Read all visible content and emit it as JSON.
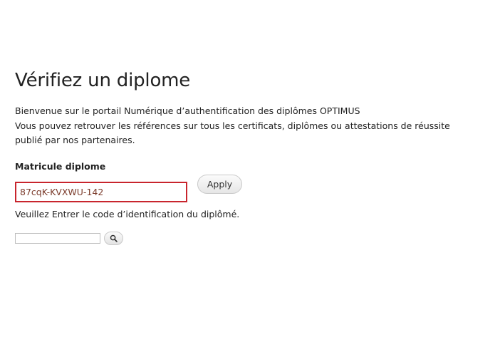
{
  "page": {
    "title": "Vérifiez un diplome",
    "intro_lines": [
      "Bienvenue sur le portail Numérique d’authentification des diplômes OPTIMUS",
      "Vous pouvez retrouver les références sur tous les certificats, diplômes ou attestations de réussite",
      "publié par nos partenaires."
    ]
  },
  "form": {
    "label": "Matricule diplome",
    "matricule_value": "87cqK-KVXWU-142",
    "apply_label": "Apply",
    "help_text": "Veuillez Entrer le code d’identification du diplômé."
  },
  "search": {
    "value": "",
    "button_icon": "search-icon"
  },
  "colors": {
    "input_border": "#c8252d",
    "input_text": "#7a3a2a"
  }
}
